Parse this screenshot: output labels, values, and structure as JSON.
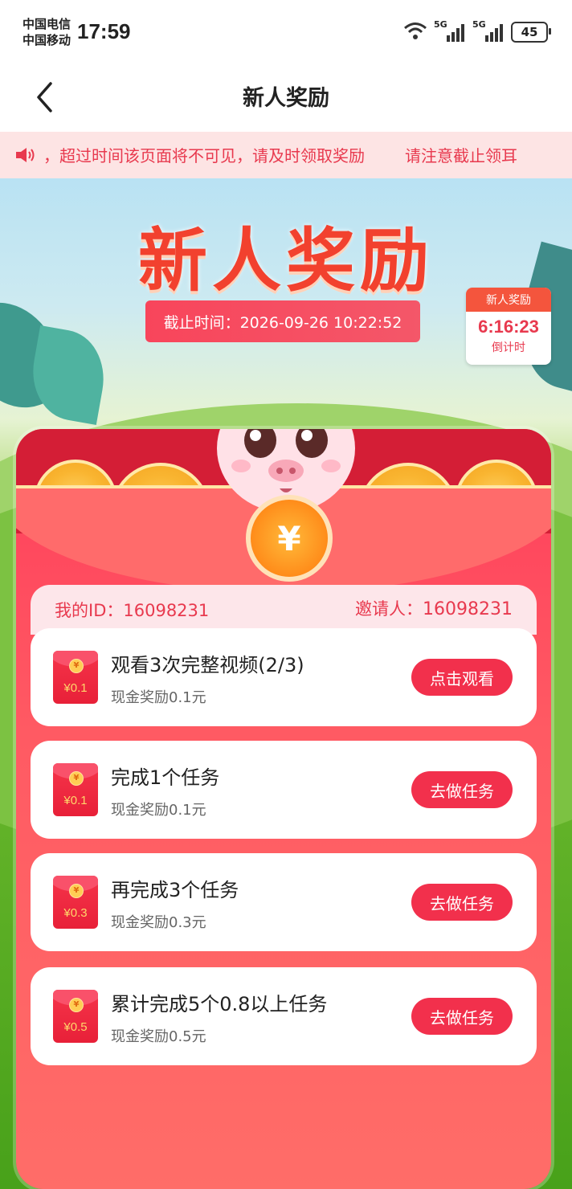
{
  "status_bar": {
    "carrier_1": "中国电信",
    "carrier_2": "中国移动",
    "time": "17:59",
    "signal_1_label": "5G",
    "signal_2_label": "5G",
    "battery": "45"
  },
  "nav": {
    "title": "新人奖励"
  },
  "notice": {
    "text": "，超过时间该页面将不可见，请及时领取奖励",
    "text_repeat": "请注意截止领耳"
  },
  "hero": {
    "title": "新人奖励",
    "deadline": "截止时间：2026-09-26 10:22:52",
    "countdown_label": "新人奖励",
    "countdown_time": "6:16:23",
    "countdown_sub": "倒计时",
    "coin_symbol": "¥"
  },
  "ids": {
    "mine_label": "我的ID：",
    "mine_value": "16098231",
    "inviter_label": "邀请人：",
    "inviter_value": "16098231"
  },
  "tasks": [
    {
      "packet_value": "¥0.1",
      "title": "观看3次完整视频(2/3)",
      "reward": "现金奖励0.1元",
      "button": "点击观看"
    },
    {
      "packet_value": "¥0.1",
      "title": "完成1个任务",
      "reward": "现金奖励0.1元",
      "button": "去做任务"
    },
    {
      "packet_value": "¥0.3",
      "title": "再完成3个任务",
      "reward": "现金奖励0.3元",
      "button": "去做任务"
    },
    {
      "packet_value": "¥0.5",
      "title": "累计完成5个0.8以上任务",
      "reward": "现金奖励0.5元",
      "button": "去做任务"
    }
  ],
  "colors": {
    "accent": "#f2304c",
    "notice_text": "#e8394e",
    "notice_bg": "#fde4e4"
  },
  "icons": {
    "back": "chevron-left-icon",
    "notice": "speaker-icon",
    "wifi": "wifi-icon",
    "signal": "signal-bars-icon",
    "battery": "battery-icon",
    "packet": "red-packet-icon"
  }
}
